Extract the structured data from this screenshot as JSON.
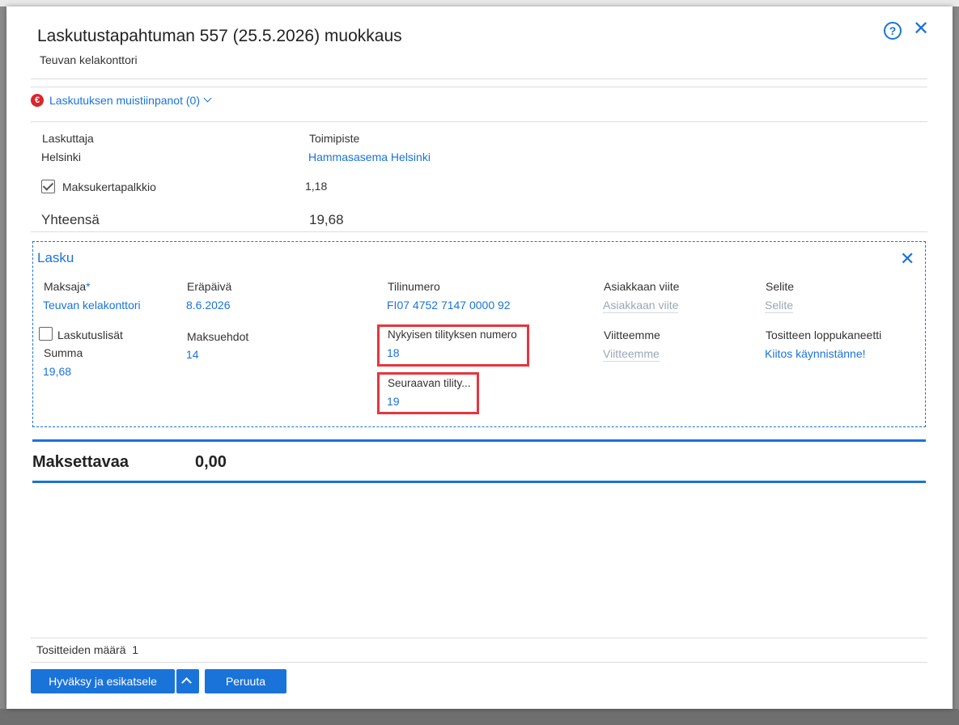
{
  "dialog": {
    "title": "Laskutustapahtuman 557 (25.5.2026) muokkaus",
    "subtitle": "Teuvan kelakonttori"
  },
  "notes_link": {
    "label": "Laskutuksen muistiinpanot (0)",
    "icon": "€"
  },
  "billing": {
    "laskuttaja_label": "Laskuttaja",
    "laskuttaja_value": "Helsinki",
    "toimipiste_label": "Toimipiste",
    "toimipiste_value": "Hammasasema Helsinki",
    "fee_label": "Maksukertapalkkio",
    "fee_value": "1,18",
    "fee_checked": true,
    "total_label": "Yhteensä",
    "total_value": "19,68"
  },
  "lasku": {
    "title": "Lasku",
    "maksaja_label": "Maksaja",
    "maksaja_required": "*",
    "maksaja_value": "Teuvan kelakonttori",
    "erapaiva_label": "Eräpäivä",
    "erapaiva_value": "8.6.2026",
    "tilinumero_label": "Tilinumero",
    "tilinumero_value": "FI07 4752 7147 0000 92",
    "asiakkaan_viite_label": "Asiakkaan viite",
    "asiakkaan_viite_placeholder": "Asiakkaan viite",
    "selite_label": "Selite",
    "selite_placeholder": "Selite",
    "laskutuslisat_label": "Laskutuslisät",
    "summa_label": "Summa",
    "summa_value": "19,68",
    "maksuehdot_label": "Maksuehdot",
    "maksuehdot_value": "14",
    "nykyisen_label": "Nykyisen tilityksen numero",
    "nykyisen_value": "18",
    "viitteemme_label": "Viitteemme",
    "viitteemme_placeholder": "Viitteemme",
    "tositteen_label": "Tositteen loppukaneetti",
    "tositteen_value": "Kiitos käynnistänne!",
    "seuraavan_label": "Seuraavan tility...",
    "seuraavan_value": "19"
  },
  "payable": {
    "label": "Maksettavaa",
    "value": "0,00"
  },
  "footer": {
    "count_label": "Tositteiden määrä",
    "count_value": "1",
    "approve_label": "Hyväksy ja esikatsele",
    "cancel_label": "Peruuta"
  },
  "colors": {
    "accent": "#1a73d9",
    "highlight": "#e5363d",
    "euro_badge": "#d9262c"
  }
}
